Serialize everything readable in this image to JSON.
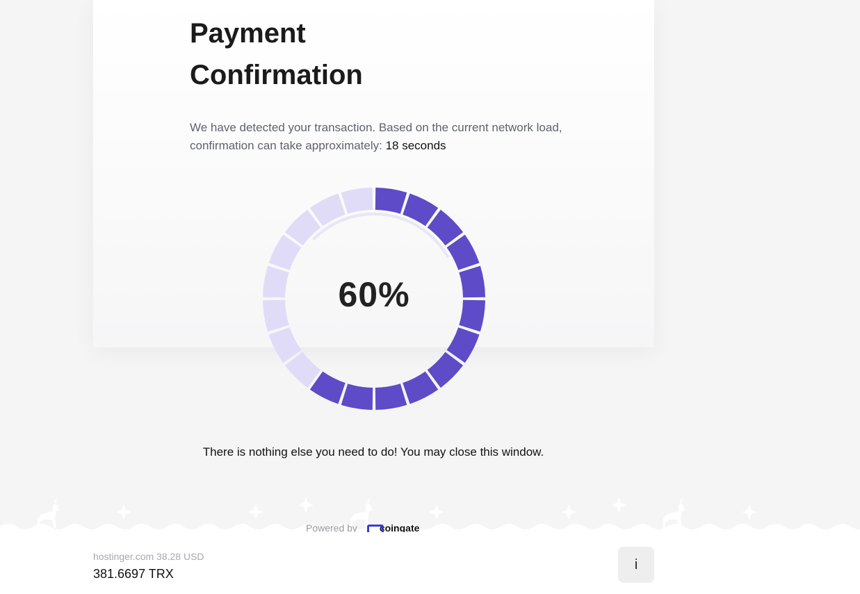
{
  "page": {
    "title_line1": "Payment",
    "title_line2": "Confirmation",
    "description": "We have detected your transaction. Based on the current network load, confirmation can take approximately:",
    "eta": "18 seconds",
    "progress_percent_label": "60%",
    "progress": {
      "filled_segments": 12,
      "total_segments": 20
    },
    "note": "There is nothing else you need to do! You may close this window.",
    "powered_prefix": "Powered by",
    "powered_brand": "coingate"
  },
  "colors": {
    "progress_filled": "#5e4bc7",
    "progress_empty": "#e0dcf7",
    "accent": "#3b3bd1"
  },
  "footer": {
    "merchant_line": "hostinger.com 38.28 USD",
    "crypto_amount": "381.6697 TRX",
    "info_button_label": "i"
  }
}
